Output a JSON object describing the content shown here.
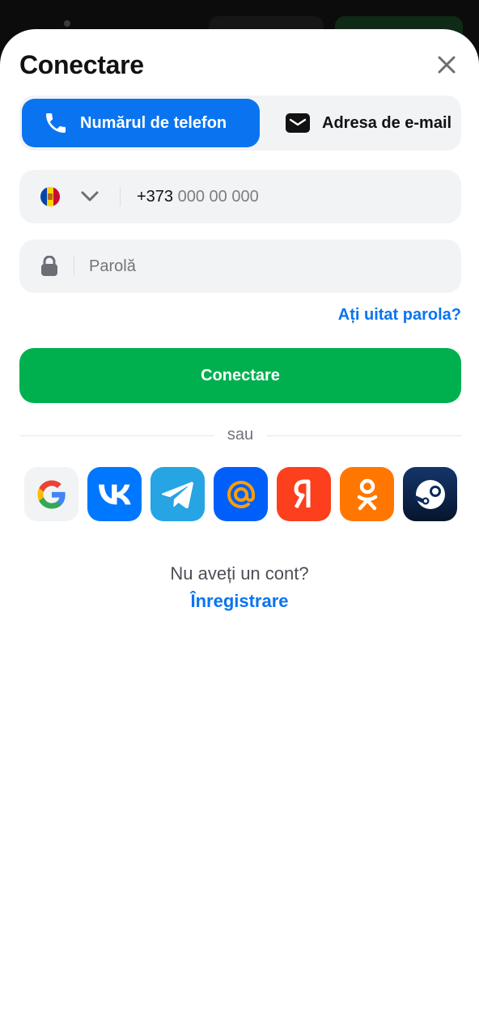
{
  "sheet": {
    "title": "Conectare",
    "close_icon": "close-icon"
  },
  "tabs": [
    {
      "label": "Numărul de telefon",
      "icon": "phone-icon",
      "active": true
    },
    {
      "label": "Adresa de e-mail",
      "icon": "mail-icon",
      "active": false
    }
  ],
  "phone": {
    "country_flag": "moldova-flag-icon",
    "code": "+373",
    "placeholder": "000 00 000"
  },
  "password": {
    "placeholder": "Parolă",
    "icon": "lock-icon"
  },
  "forgot_label": "Ați uitat parola?",
  "submit_label": "Conectare",
  "or_label": "sau",
  "social_logins": [
    {
      "name": "Google",
      "icon": "google-icon",
      "color": "#f2f3f5"
    },
    {
      "name": "VK",
      "icon": "vk-icon",
      "color": "#0077ff"
    },
    {
      "name": "Telegram",
      "icon": "telegram-icon",
      "color": "#26a4e3"
    },
    {
      "name": "Mail.ru",
      "icon": "mailru-icon",
      "color": "#005ff9"
    },
    {
      "name": "Yandex",
      "icon": "yandex-icon",
      "color": "#fc3f1d"
    },
    {
      "name": "Odnoklassniki",
      "icon": "ok-icon",
      "color": "#ff7700"
    },
    {
      "name": "Steam",
      "icon": "steam-icon",
      "color": "#0b2a5b"
    }
  ],
  "footer": {
    "question": "Nu aveți un cont?",
    "register_label": "Înregistrare"
  },
  "colors": {
    "accent": "#0a74f0",
    "submit": "#00b04f",
    "field_bg": "#f2f3f5"
  }
}
